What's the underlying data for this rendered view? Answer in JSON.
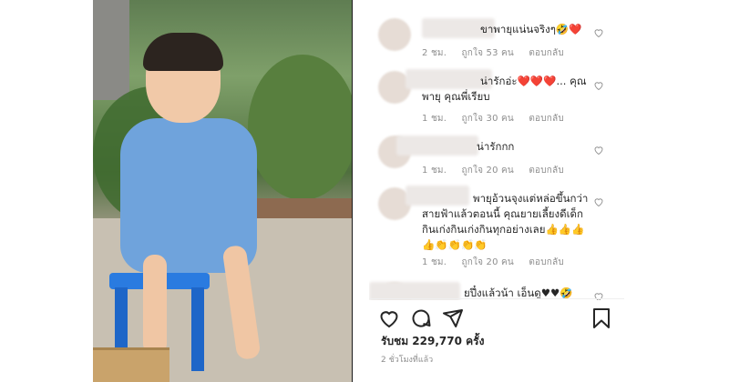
{
  "comments": [
    {
      "text": "ขาพายุแน่นจริงๆ🤣❤️",
      "time": "2 ชม.",
      "likes": "ถูกใจ 53 คน",
      "reply": "ตอบกลับ"
    },
    {
      "text": "น่ารักอ่ะ❤️❤️❤️... คุณพายุ คุณพี่เรียบ",
      "time": "1 ชม.",
      "likes": "ถูกใจ 30 คน",
      "reply": "ตอบกลับ"
    },
    {
      "text": "น่ารักกก",
      "time": "1 ชม.",
      "likes": "ถูกใจ 20 คน",
      "reply": "ตอบกลับ"
    },
    {
      "text": "พายุอ้วนจุงแต่หล่อขึ้นกว่าสายฟ้าแล้วตอนนี้ คุณยายเลี้ยงดีเด็กกินเก่งกินเก่งกินทุกอย่างเลย👍👍👍👍👏👏👏👏",
      "time": "1 ชม.",
      "likes": "ถูกใจ 20 คน",
      "reply": "ตอบกลับ"
    },
    {
      "text": "ยปึ๋งแล้วน้า เอ็นดู♥♥🤣",
      "time": "",
      "likes": "",
      "reply": ""
    }
  ],
  "post": {
    "views": "รับชม 229,770 ครั้ง",
    "posted": "2 ชั่วโมงที่แล้ว"
  },
  "icons": {
    "like": "heart-icon",
    "comment": "comment-icon",
    "share": "share-icon",
    "save": "bookmark-icon"
  }
}
